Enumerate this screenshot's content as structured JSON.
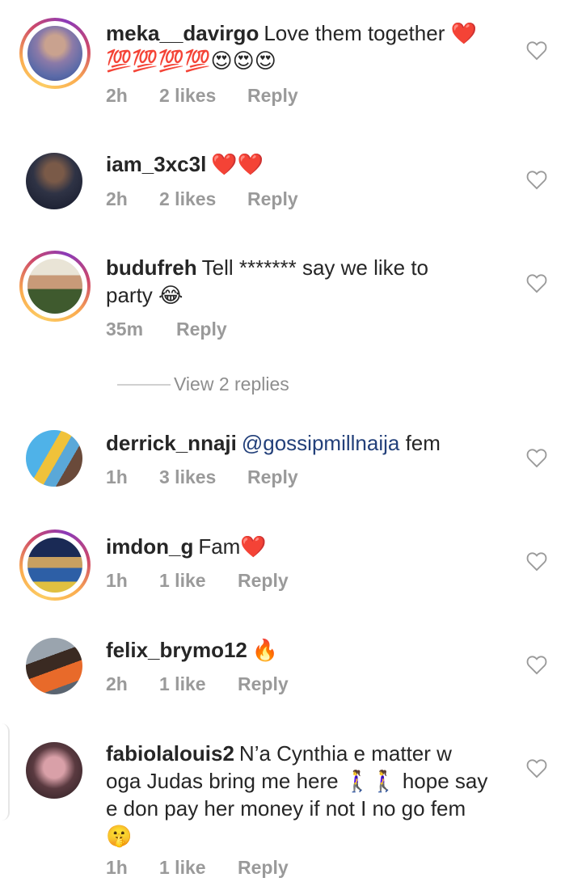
{
  "comments": [
    {
      "username": "meka__davirgo",
      "text": "Love them together ❤️",
      "text2": "💯💯💯💯😍😍😍",
      "time": "2h",
      "likes": "2 likes",
      "reply": "Reply",
      "has_story_ring": true,
      "avatar_color": "#6a7fb5"
    },
    {
      "username": "iam_3xc3l",
      "text": "❤️❤️",
      "time": "2h",
      "likes": "2 likes",
      "reply": "Reply",
      "has_story_ring": false,
      "avatar_color": "#3a3e52"
    },
    {
      "username": "budufreh",
      "text": "Tell ******* say we like to",
      "text2": "party 😂",
      "time": "35m",
      "reply": "Reply",
      "has_story_ring": true,
      "avatar_color": "#4a5a3a"
    },
    {
      "username": "derrick_nnaji",
      "mention": "@gossipmillnaija",
      "text": " fem",
      "time": "1h",
      "likes": "3 likes",
      "reply": "Reply",
      "has_story_ring": false,
      "avatar_color": "#5aa8d8"
    },
    {
      "username": "imdon_g",
      "text": "Fam❤️",
      "time": "1h",
      "likes": "1 like",
      "reply": "Reply",
      "has_story_ring": true,
      "avatar_color": "#2d5fa6"
    },
    {
      "username": "felix_brymo12",
      "text": "🔥",
      "time": "2h",
      "likes": "1 like",
      "reply": "Reply",
      "has_story_ring": false,
      "avatar_color": "#7d8690"
    },
    {
      "username": "fabiolalouis2",
      "text": "N’a Cynthia e matter w",
      "text2": "oga Judas bring me here 🚶‍♀️🚶‍♀️ hope say",
      "text3": "e don pay her money if not I no go fem",
      "text4": "🤫",
      "time": "1h",
      "likes": "1 like",
      "reply": "Reply",
      "has_story_ring": false,
      "avatar_color": "#6b4a52"
    }
  ],
  "view_replies": "View 2 replies",
  "icons": {
    "like": "heart-outline-icon"
  },
  "colors": {
    "meta": "#9a9a9a",
    "mention": "#23407a",
    "heart": "#e0245e"
  }
}
